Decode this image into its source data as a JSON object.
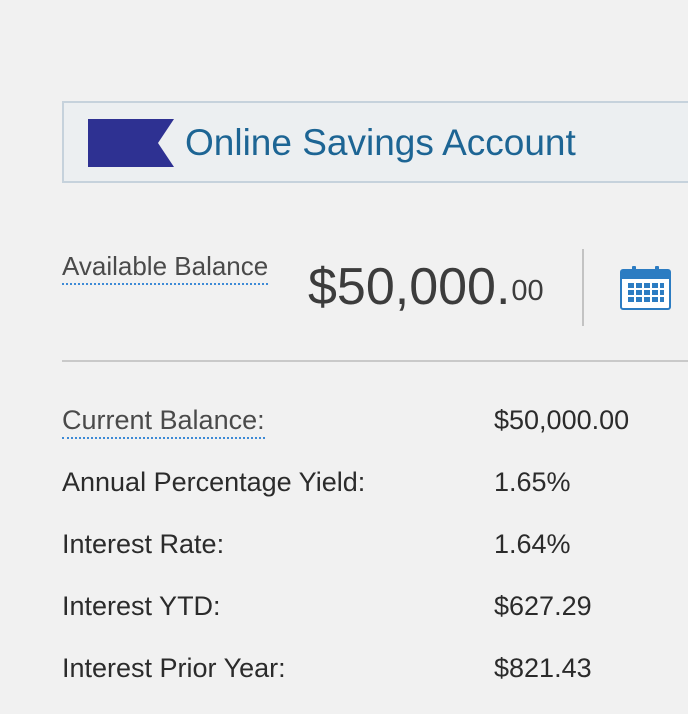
{
  "account": {
    "name": "Online Savings Account",
    "icon": "bookmark-ribbon-icon",
    "icon_color": "#2e3192"
  },
  "available_balance": {
    "label": "Available Balance",
    "dollars": "$50,000.",
    "cents": "00"
  },
  "calendar": {
    "icon": "calendar-icon",
    "color": "#2c7cc2"
  },
  "details": [
    {
      "label": "Current Balance:",
      "value": "$50,000.00"
    },
    {
      "label": "Annual Percentage Yield:",
      "value": "1.65%"
    },
    {
      "label": "Interest Rate:",
      "value": "1.64%"
    },
    {
      "label": "Interest YTD:",
      "value": "$627.29"
    },
    {
      "label": "Interest Prior Year:",
      "value": "$821.43"
    }
  ]
}
